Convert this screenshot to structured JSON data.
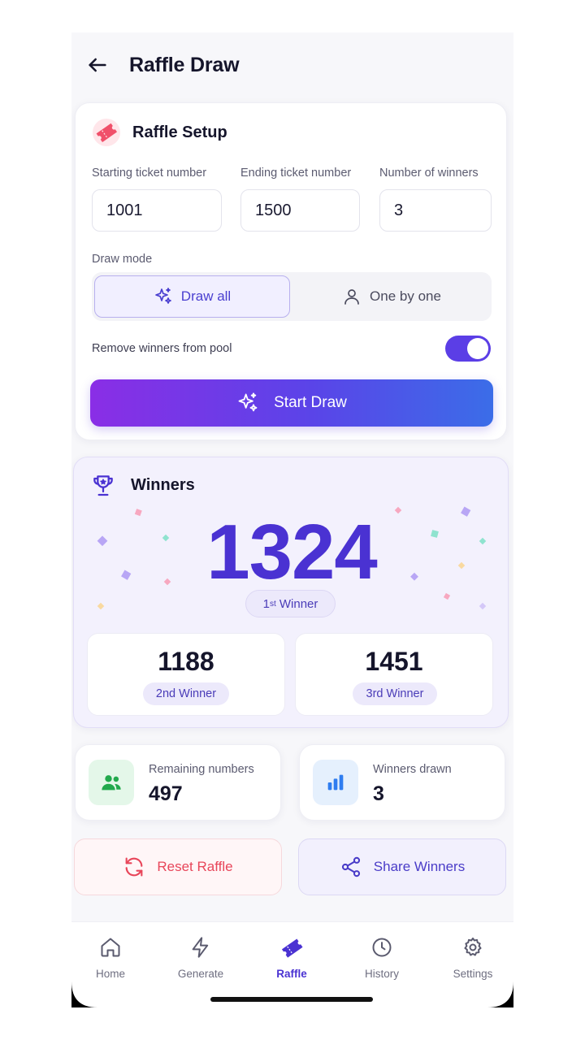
{
  "header": {
    "title": "Raffle Draw"
  },
  "setup": {
    "title": "Raffle Setup",
    "fields": [
      {
        "label": "Starting ticket number",
        "value": "1001"
      },
      {
        "label": "Ending ticket number",
        "value": "1500"
      },
      {
        "label": "Number of winners",
        "value": "3"
      }
    ],
    "draw_mode_label": "Draw mode",
    "draw_modes": [
      {
        "label": "Draw all",
        "icon": "sparkles-icon",
        "selected": true
      },
      {
        "label": "One by one",
        "icon": "person-icon",
        "selected": false
      }
    ],
    "toggle_label": "Remove winners from pool",
    "toggle_on": true,
    "start_button": "Start Draw"
  },
  "winners": {
    "title": "Winners",
    "first": {
      "number": "1324",
      "label_prefix": "1",
      "label_suffix": "st",
      "label_rest": " Winner"
    },
    "others": [
      {
        "number": "1188",
        "label": "2nd Winner"
      },
      {
        "number": "1451",
        "label": "3rd Winner"
      }
    ]
  },
  "stats": [
    {
      "label": "Remaining numbers",
      "value": "497",
      "icon": "users-icon",
      "color": "#22a94d"
    },
    {
      "label": "Winners drawn",
      "value": "3",
      "icon": "bar-chart-icon",
      "color": "#2f7df0"
    }
  ],
  "actions": {
    "reset": "Reset Raffle",
    "share": "Share Winners"
  },
  "nav": [
    {
      "label": "Home",
      "icon": "home-icon",
      "active": false
    },
    {
      "label": "Generate",
      "icon": "bolt-icon",
      "active": false
    },
    {
      "label": "Raffle",
      "icon": "ticket-icon",
      "active": true
    },
    {
      "label": "History",
      "icon": "clock-icon",
      "active": false
    },
    {
      "label": "Settings",
      "icon": "gear-icon",
      "active": false
    }
  ],
  "colors": {
    "accent": "#4a32d2",
    "danger": "#e8465a",
    "toggle": "#5b3ee6"
  }
}
